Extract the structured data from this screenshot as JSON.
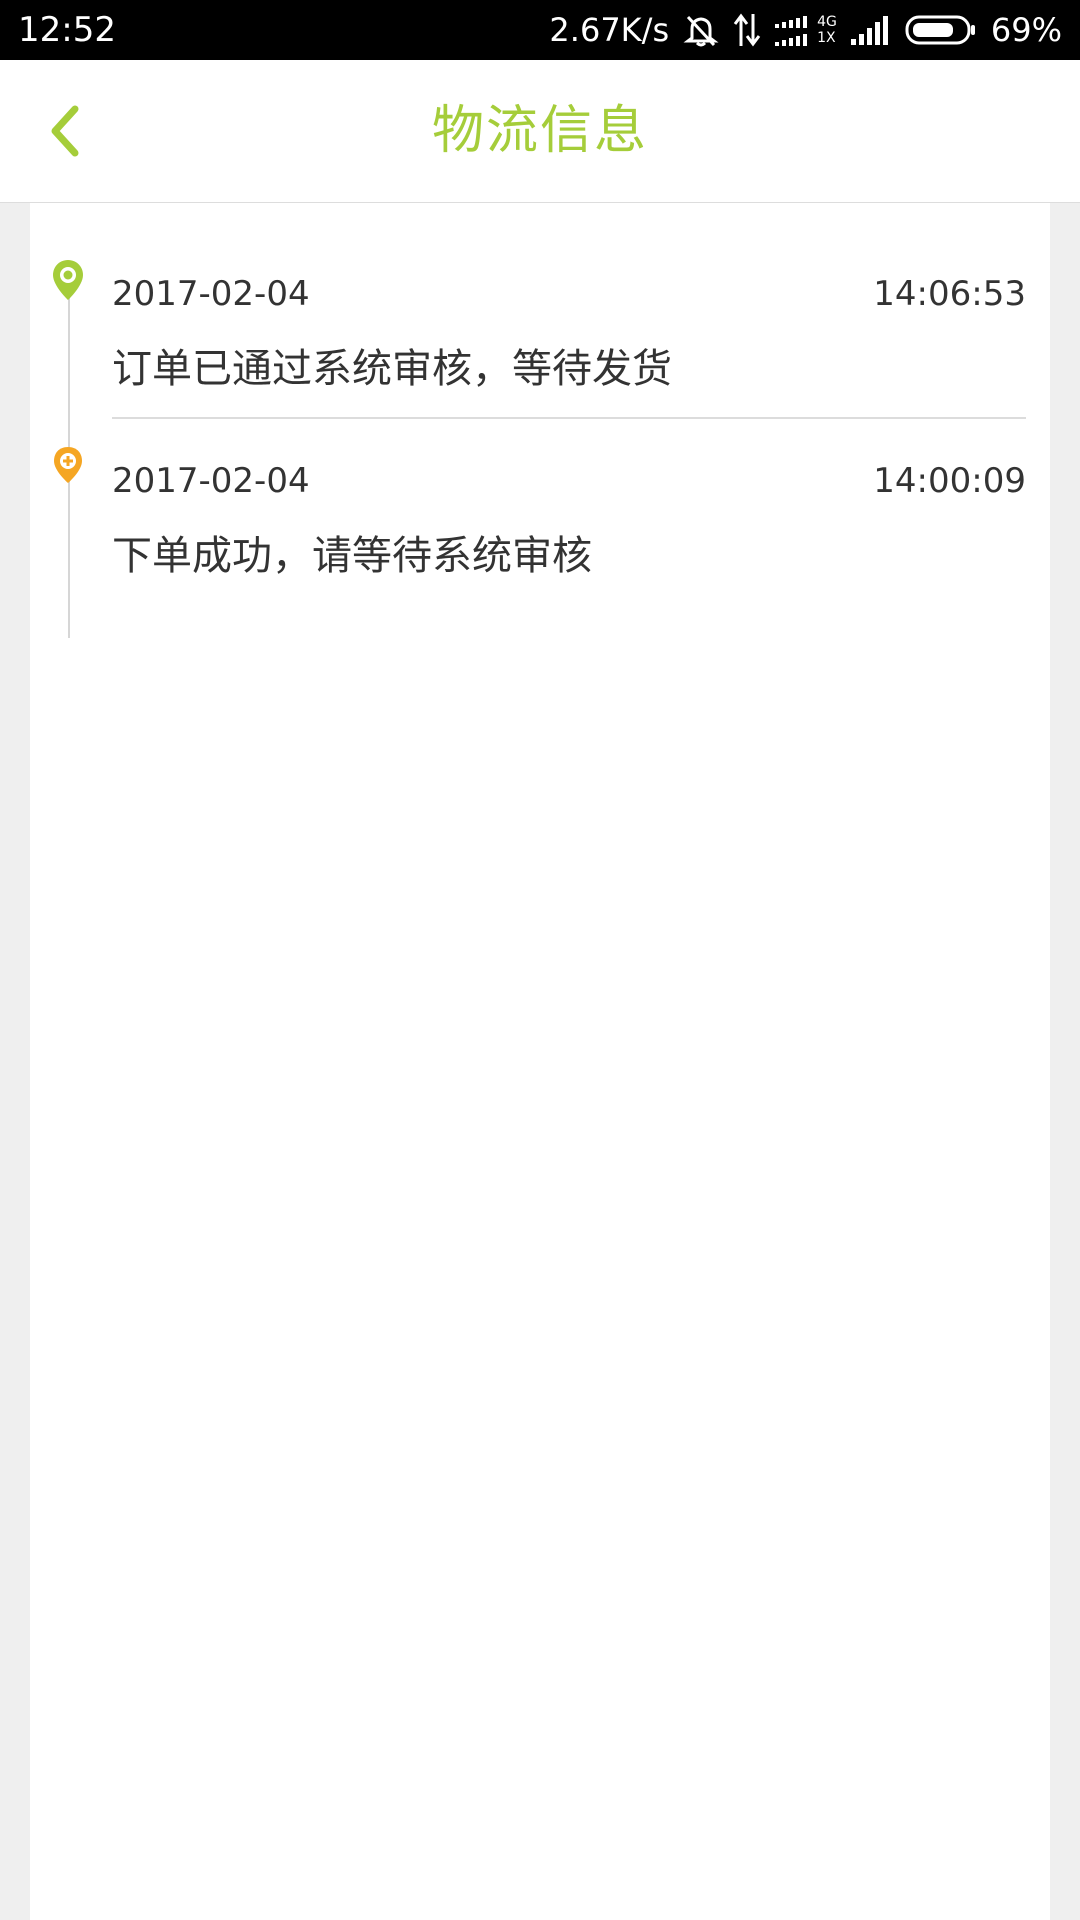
{
  "status_bar": {
    "time": "12:52",
    "net_speed": "2.67K/s",
    "network_label_top": "4G",
    "network_label_bottom": "1X",
    "battery_percent": "69%",
    "icons": [
      "mute-icon",
      "data-transfer-icon",
      "signal-icon",
      "signal-icon",
      "battery-icon"
    ]
  },
  "header": {
    "back_icon": "chevron-left-icon",
    "title": "物流信息",
    "accent_color": "#a5cd3a"
  },
  "timeline": {
    "events": [
      {
        "date": "2017-02-04",
        "time": "14:06:53",
        "description": "订单已通过系统审核，等待发货",
        "marker_icon": "location-pin-icon",
        "marker_color": "#a5cd3a"
      },
      {
        "date": "2017-02-04",
        "time": "14:00:09",
        "description": "下单成功，请等待系统审核",
        "marker_icon": "location-pin-plus-icon",
        "marker_color": "#f5a623"
      }
    ]
  }
}
